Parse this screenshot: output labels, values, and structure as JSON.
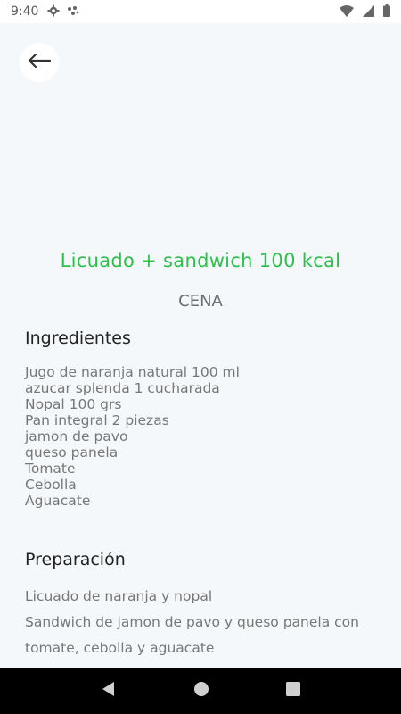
{
  "status_bar": {
    "time": "9:40"
  },
  "recipe": {
    "title": "Licuado + sandwich 100 kcal",
    "category": "CENA",
    "ingredients_heading": "Ingredientes",
    "ingredients": [
      "Jugo de naranja natural 100 ml",
      "azucar splenda 1 cucharada",
      "Nopal 100 grs",
      "Pan integral 2 piezas",
      "jamon de pavo",
      "queso panela",
      "Tomate",
      "Cebolla",
      "Aguacate"
    ],
    "preparation_heading": "Preparación",
    "preparation": [
      "Licuado de naranja y nopal",
      "Sandwich de jamon de pavo y queso panela con tomate, cebolla y aguacate"
    ]
  },
  "colors": {
    "accent": "#2ec14a",
    "background": "#f5f8fa"
  },
  "icons": [
    "gear-icon",
    "assistant-icon",
    "wifi-icon",
    "signal-icon",
    "battery-icon",
    "back-arrow-icon",
    "nav-back-icon",
    "nav-home-icon",
    "nav-recents-icon"
  ]
}
